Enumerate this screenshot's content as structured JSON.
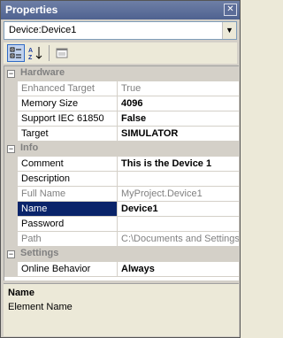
{
  "window": {
    "title": "Properties"
  },
  "object_selector": {
    "value": "Device:Device1"
  },
  "toolbar": {
    "categorized": "categorized-view",
    "alphabetical": "alphabetical-view",
    "property_pages": "property-pages"
  },
  "categories": [
    {
      "label": "Hardware",
      "properties": [
        {
          "name": "Enhanced Target",
          "value": "True",
          "readonly": true
        },
        {
          "name": "Memory Size",
          "value": "4096",
          "bold": true
        },
        {
          "name": "Support IEC 61850",
          "value": "False",
          "bold": true
        },
        {
          "name": "Target",
          "value": "SIMULATOR",
          "bold": true
        }
      ]
    },
    {
      "label": "Info",
      "properties": [
        {
          "name": "Comment",
          "value": "This is the Device 1",
          "bold": true
        },
        {
          "name": "Description",
          "value": ""
        },
        {
          "name": "Full Name",
          "value": "MyProject.Device1",
          "readonly": true
        },
        {
          "name": "Name",
          "value": "Device1",
          "bold": true,
          "selected": true
        },
        {
          "name": "Password",
          "value": ""
        },
        {
          "name": "Path",
          "value": "C:\\Documents and Settings\\",
          "readonly": true
        }
      ]
    },
    {
      "label": "Settings",
      "properties": [
        {
          "name": "Online Behavior",
          "value": "Always",
          "bold": true
        }
      ]
    }
  ],
  "help": {
    "title": "Name",
    "description": "Element Name"
  },
  "colors": {
    "titlebar": "#4f6290",
    "selection": "#0a246a",
    "category_bg": "#d4d0c8"
  }
}
